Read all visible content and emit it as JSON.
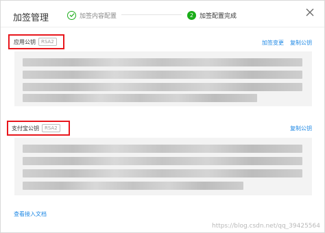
{
  "dialog": {
    "title": "加签管理",
    "steps": [
      {
        "label": "加签内容配置",
        "state": "done"
      },
      {
        "number": "2",
        "label": "加签配置完成",
        "state": "active"
      }
    ]
  },
  "app_key_section": {
    "title": "应用公钥",
    "badge": "RSA2",
    "actions": [
      "加签变更",
      "复制公钥"
    ]
  },
  "alipay_key_section": {
    "title": "支付宝公钥",
    "badge": "RSA2",
    "actions": [
      "复制公钥"
    ]
  },
  "footer": {
    "doc_link": "查看接入文档"
  },
  "watermark": "https://blog.csdn.net/qq_39425564",
  "colors": {
    "accent_green": "#1aad19",
    "link_blue": "#1e88e5",
    "highlight_red": "#e8151b"
  }
}
